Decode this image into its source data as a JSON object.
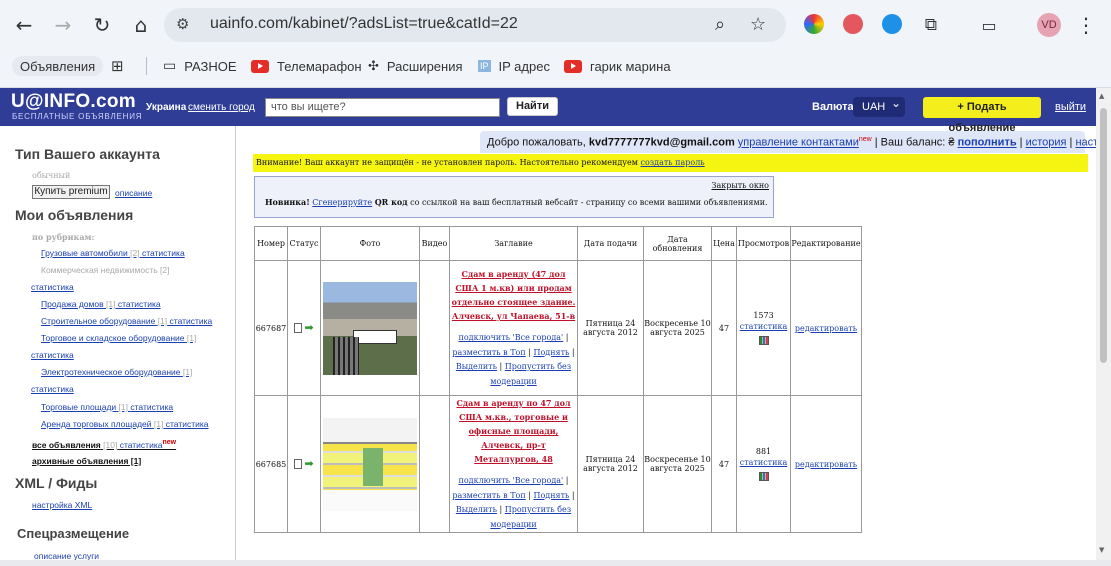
{
  "browser": {
    "url": "uainfo.com/kabinet/?adsList=true&catId=22",
    "avatar_initials": "VD",
    "bookmarks": [
      {
        "label": "Объявления"
      },
      {
        "label": "РАЗНОЕ"
      },
      {
        "label": "Телемарафон"
      },
      {
        "label": "Расширения"
      },
      {
        "label": "IP адрес"
      },
      {
        "label": "гарик марина"
      }
    ],
    "ip_badge": "IP"
  },
  "header": {
    "logo": "U@INFO.com",
    "logo_sub": "БЕСПЛАТНЫЕ ОБЪЯВЛЕНИЯ",
    "region": "Украина",
    "change_region": "сменить город",
    "search_placeholder": "что вы ищете?",
    "find_button": "Найти",
    "currency_label": "Валюта:",
    "currency_value": "UAH",
    "post_button": "+ Подать объявление",
    "logout": "выйти",
    "colors": {
      "header_bg": "#2f3d96",
      "post_button_bg": "#f4ef1c"
    }
  },
  "sidebar": {
    "account_heading": "Тип Вашего аккаунта",
    "account_type": "обычный",
    "buy_premium": "Купить premium",
    "description": "описание",
    "my_ads_heading": "Мои объявления",
    "by_rubrics": "по рубрикам:",
    "rubrics": [
      {
        "label": "Грузовые автомобили",
        "count": "[2]",
        "stats": "статистика"
      },
      {
        "label": "Коммерческая недвижимость",
        "count": "[2]",
        "stats": "статистика"
      },
      {
        "label": "Продажа домов",
        "count": "[1]",
        "stats": "статистика"
      },
      {
        "label": "Строительное оборудование",
        "count": "[1]",
        "stats": "статистика"
      },
      {
        "label": "Торговое и складское оборудование",
        "count": "[1]",
        "stats": "статистика"
      },
      {
        "label": "Электротехническое оборудование",
        "count": "[1]",
        "stats": "статистика"
      },
      {
        "label": "Торговые площади",
        "count": "[1]",
        "stats": "статистика"
      },
      {
        "label": "Аренда торговых площадей",
        "count": "[1]",
        "stats": "статистика"
      }
    ],
    "all_ads": "все объявления",
    "all_ads_count": "[10]",
    "all_stats": "статистика",
    "new_badge": "new",
    "archived": "архивные объявления [1]",
    "xml_heading": "XML / Фиды",
    "xml_settings": "настройка XML",
    "special_heading": "Спецразмещение",
    "service_description": "описание услуги"
  },
  "welcome": {
    "greeting": "Добро пожаловать,",
    "email": "kvd7777777kvd@gmail.com",
    "manage_contacts": "управление контактами",
    "new_badge": "new",
    "balance_label": "| Ваш баланс: ₴",
    "topup": "пополнить",
    "history": "история",
    "settings": "настройки",
    "sep": "|"
  },
  "warning": {
    "text": "Внимание! Ваш аккаунт не защищён - не установлен пароль. Настоятельно рекомендуем",
    "link": "создать пароль"
  },
  "news": {
    "close": "Закрыть окно",
    "bold": "Новинка!",
    "link": "Сгенерируйте",
    "qr": "QR код",
    "rest": "со ссылкой на ваш бесплатный вебсайт - страницу со всеми вашими объявлениями."
  },
  "table": {
    "headers": [
      "Номер",
      "Статус",
      "Фото",
      "Видео",
      "Заглавие",
      "Дата подачи",
      "Дата обновления",
      "Цена",
      "Просмотров",
      "Редактирование"
    ],
    "rows": [
      {
        "id": "667687",
        "title": "Сдам в аренду (47 дол США 1 м.кв) или продам отдельно стоящее здание. Алчевск, ул Чапаева, 51-в",
        "connect": "подключить 'Все города'",
        "top": "разместить в Топ",
        "raise": "Поднять",
        "highlight": "Выделить",
        "skip": "Пропустить без модерации",
        "date_posted": "Пятница 24 августа 2012",
        "date_updated": "Воскресенье 10 августа 2025",
        "price": "47",
        "views": "1573",
        "stats": "статистика",
        "edit": "редактировать"
      },
      {
        "id": "667685",
        "title": "Сдам в аренду по 47 дол США м.кв., торговые и офисные площади, Алчевск, пр-т Металлургов, 48",
        "connect": "подключить 'Все города'",
        "top": "разместить в Топ",
        "raise": "Поднять",
        "highlight": "Выделить",
        "skip": "Пропустить без модерации",
        "date_posted": "Пятница 24 августа 2012",
        "date_updated": "Воскресенье 10 августа 2025",
        "price": "47",
        "views": "881",
        "stats": "статистика",
        "edit": "редактировать"
      }
    ]
  }
}
